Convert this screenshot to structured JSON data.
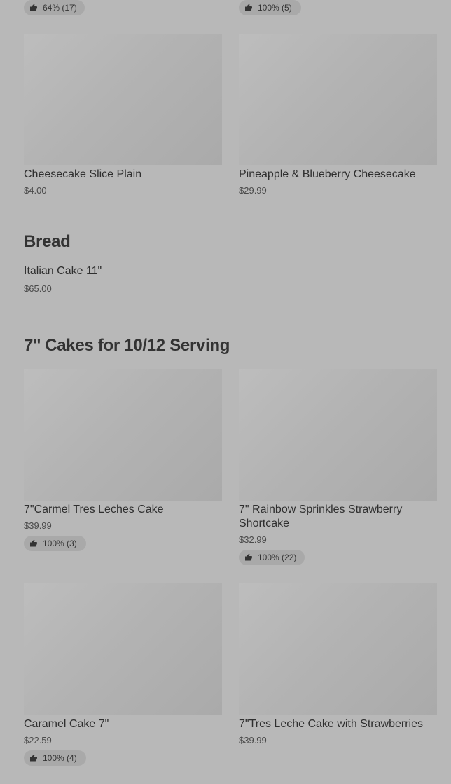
{
  "top_badges": [
    {
      "label": "64% (17)"
    },
    {
      "label": "100% (5)"
    }
  ],
  "cheesecake_row": [
    {
      "title": "Cheesecake Slice Plain",
      "price": "$4.00"
    },
    {
      "title": "Pineapple & Blueberry Cheesecake",
      "price": "$29.99"
    }
  ],
  "bread_section": {
    "title": "Bread",
    "items": [
      {
        "title": "Italian Cake 11\"",
        "price": "$65.00"
      }
    ]
  },
  "cakes_section": {
    "title": "7'' Cakes for 10/12 Serving",
    "items": [
      {
        "title": "7\"Carmel Tres Leches Cake",
        "price": "$39.99",
        "badge": "100% (3)"
      },
      {
        "title": "7\" Rainbow Sprinkles Strawberry Shortcake",
        "price": "$32.99",
        "badge": "100% (22)"
      },
      {
        "title": "Caramel Cake 7\"",
        "price": "$22.59",
        "badge": "100% (4)"
      },
      {
        "title": "7\"Tres Leche Cake with Strawberries",
        "price": "$39.99"
      }
    ]
  },
  "icons": {
    "rating": "thumbs-up-icon"
  }
}
